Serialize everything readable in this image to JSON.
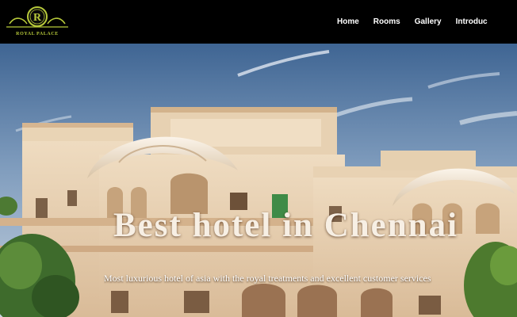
{
  "brand": {
    "logo_letter": "R",
    "name": "ROYAL PALACE",
    "logo_color": "#b7c93a"
  },
  "nav": {
    "items": [
      {
        "label": "Home"
      },
      {
        "label": "Rooms"
      },
      {
        "label": "Gallery"
      },
      {
        "label": "Introduc"
      }
    ]
  },
  "hero": {
    "title": "Best hotel in Chennai",
    "subtitle": "Most luxurious hotel of asia with the royal treatments and excellent customer services"
  },
  "colors": {
    "topbar_bg": "#000000",
    "sky_top": "#3f6593",
    "sky_bottom": "#c7d3df",
    "facade": "#e6cfb0",
    "text": "#ffffff"
  }
}
